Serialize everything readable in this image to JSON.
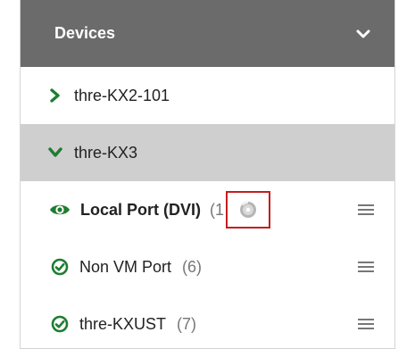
{
  "panel": {
    "title": "Devices",
    "icons": {
      "collapse": "chevron-down-icon"
    }
  },
  "groups": [
    {
      "label": "thre-KX2-101",
      "expanded": false,
      "icon": "chevron-right-icon"
    },
    {
      "label": "thre-KX3",
      "expanded": true,
      "icon": "chevron-down-icon"
    }
  ],
  "ports": [
    {
      "label": "Local Port (DVI)",
      "count": "(1",
      "status_icon": "eye-icon",
      "extra_icon": "disc-icon",
      "menu_icon": "hamburger-icon",
      "active": true
    },
    {
      "label": "Non VM Port",
      "count": "(6)",
      "status_icon": "check-circle-icon",
      "menu_icon": "hamburger-icon",
      "active": false
    },
    {
      "label": "thre-KXUST",
      "count": "(7)",
      "status_icon": "check-circle-icon",
      "menu_icon": "hamburger-icon",
      "active": false
    }
  ],
  "colors": {
    "header_bg": "#6b6b6b",
    "selected_bg": "#cfcfcf",
    "accent_green": "#1e7d32",
    "highlight_red": "#c41e1e"
  }
}
